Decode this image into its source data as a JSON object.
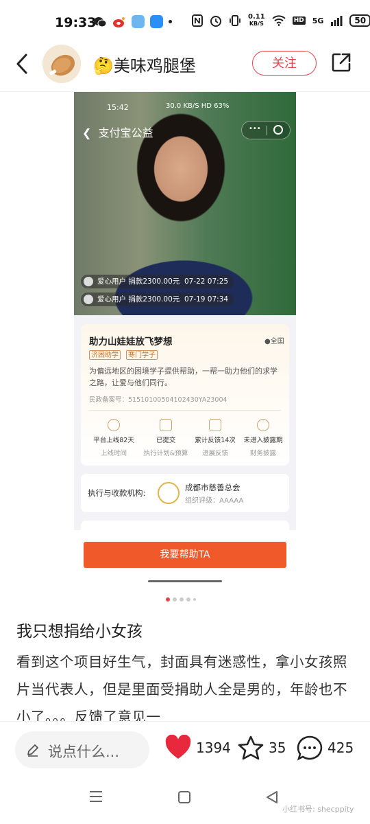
{
  "status_bar": {
    "time": "19:33",
    "net_speed_top": "0.11",
    "net_speed_bottom": "KB/S",
    "network": "5G",
    "battery": "50"
  },
  "header": {
    "author_emoji": "🤔",
    "author_name": "美味鸡腿堡",
    "follow_label": "关注"
  },
  "embedded": {
    "time": "15:42",
    "status_text": "30.0 KB/S HD 63%",
    "nav_title": "支付宝公益",
    "menu_dots": "•••",
    "donors": [
      {
        "text": "爱心用户 捐款2300.00元",
        "time": "07-22 07:25"
      },
      {
        "text": "爱心用户 捐款2300.00元",
        "time": "07-19 07:34"
      }
    ],
    "project": {
      "title": "助力山娃娃放飞梦想",
      "location": "全国",
      "tags": [
        "济困助学",
        "寒门学子"
      ],
      "description": "为偏远地区的困境学子提供帮助，一帮一助力他们的求学之路，让爱与他们同行。",
      "registration": "民政备案号：51510100504102430YA23004",
      "stats": [
        {
          "value": "平台上线82天",
          "label": "上线时间"
        },
        {
          "value": "已提交",
          "label": "执行计划&预算"
        },
        {
          "value": "累计反馈14次",
          "label": "进展反馈"
        },
        {
          "value": "未进入披露期",
          "label": "财务披露"
        }
      ]
    },
    "executor": {
      "label": "执行与收款机构:",
      "org_name": "成都市慈善总会",
      "rating": "组织评级：AAAAA"
    },
    "help_button": "我要帮助TA"
  },
  "post": {
    "title": "我只想捐给小女孩",
    "body": "看到这个项目好生气，封面具有迷惑性，拿小女孩照片当代表人，但是里面受捐助人全是男的，年龄也不小了。。。反馈了意见一"
  },
  "bottom_bar": {
    "comment_placeholder": "说点什么...",
    "likes": "1394",
    "favorites": "35",
    "comments": "425"
  },
  "watermark": "小红书号: shecppity",
  "colors": {
    "accent": "#e8424f",
    "help_button": "#f0592a",
    "tag": "#c8742a"
  }
}
